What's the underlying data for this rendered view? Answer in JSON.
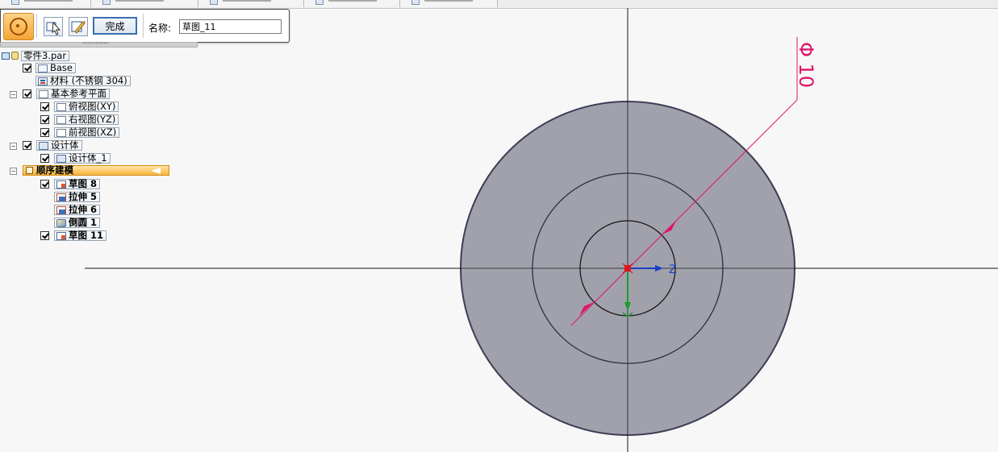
{
  "doc_tabs": [
    {
      "label": ""
    },
    {
      "label": ""
    },
    {
      "label": ""
    },
    {
      "label": ""
    },
    {
      "label": ""
    }
  ],
  "command_bar": {
    "done_label": "完成",
    "name_label": "名称:",
    "name_value": "草图_11"
  },
  "tree": {
    "root": "零件3.par",
    "base": "Base",
    "material": "材料 (不锈钢 304)",
    "ref_planes": "基本参考平面",
    "plane_xy": "俯视图(XY)",
    "plane_yz": "右视图(YZ)",
    "plane_xz": "前视图(XZ)",
    "design_body": "设计体",
    "design_body_1": "设计体_1",
    "ordered": "顺序建模",
    "features": [
      {
        "label": "草图 8",
        "type": "sketch",
        "checked": true
      },
      {
        "label": "拉伸 5",
        "type": "extrude",
        "checked": false
      },
      {
        "label": "拉伸 6",
        "type": "extrude",
        "checked": false
      },
      {
        "label": "倒圆 1",
        "type": "round",
        "checked": false
      },
      {
        "label": "草图 11",
        "type": "sketch",
        "checked": true
      }
    ]
  },
  "viewport": {
    "dimension_text": "Φ 10",
    "axis_z_label": "Z",
    "colors": {
      "background": "#f7f7f7",
      "part_fill": "#a0a1ab",
      "dimension": "#e0126a",
      "axis_z": "#1a3fc9",
      "axis_y": "#1c9b26",
      "origin": "#e0131f"
    }
  },
  "icons": [
    "sketch-mode-icon",
    "select-tool-icon",
    "draw-sketch-icon",
    "part-icon",
    "expand-icon",
    "checkbox-icon"
  ]
}
